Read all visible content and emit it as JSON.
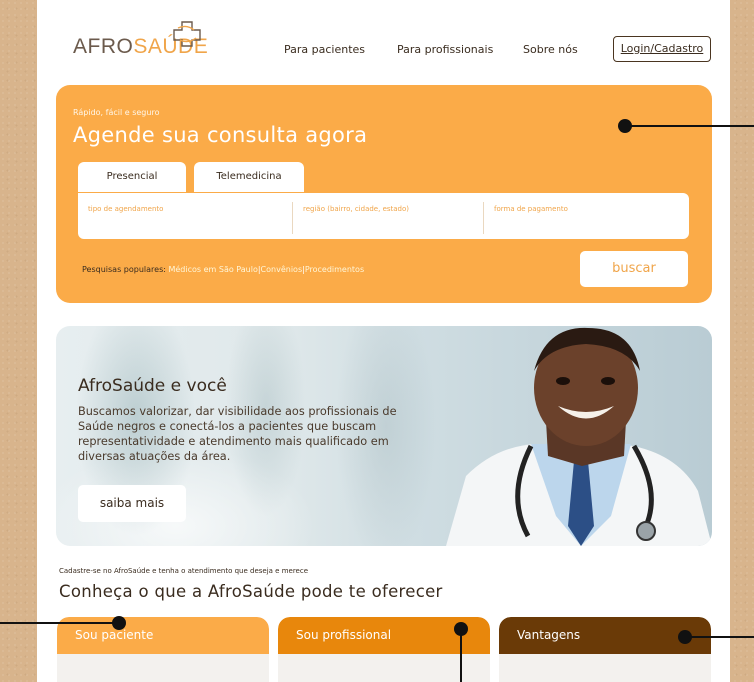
{
  "header": {
    "logo": {
      "part1": "AFRO",
      "part2": "SAÚDE"
    },
    "nav": [
      "Para pacientes",
      "Para profissionais",
      "Sobre nós"
    ],
    "login_label": "Login/Cadastro"
  },
  "search": {
    "eyebrow": "Rápido, fácil e seguro",
    "title": "Agende sua consulta agora",
    "tabs": [
      "Presencial",
      "Telemedicina"
    ],
    "fields": [
      "tipo de agendamento",
      "região (bairro, cidade, estado)",
      "forma de pagamento"
    ],
    "popular_label": "Pesquisas populares:",
    "popular_links": [
      "Médicos em São Paulo",
      "Convênios",
      "Procedimentos"
    ],
    "popular_sep": "|",
    "button_label": "buscar"
  },
  "hero": {
    "title": "AfroSaúde e você",
    "text": "Buscamos valorizar, dar visibilidade aos profissionais de Saúde negros e conectá-los a pacientes que buscam representatividade e atendimento mais qualificado em diversas atuações da área.",
    "button_label": "saiba mais"
  },
  "offer": {
    "eyebrow": "Cadastre-se no AfroSaúde e tenha o atendimento que deseja e merece",
    "title": "Conheça o que a AfroSaúde pode te oferecer",
    "cards": [
      "Sou paciente",
      "Sou profissional",
      "Vantagens"
    ]
  },
  "colors": {
    "brand_orange": "#fbab48",
    "card_orange": "#fbab48",
    "card_dark_orange": "#e8870c",
    "card_brown": "#6a3a07",
    "text_dark": "#3a2c1f"
  }
}
